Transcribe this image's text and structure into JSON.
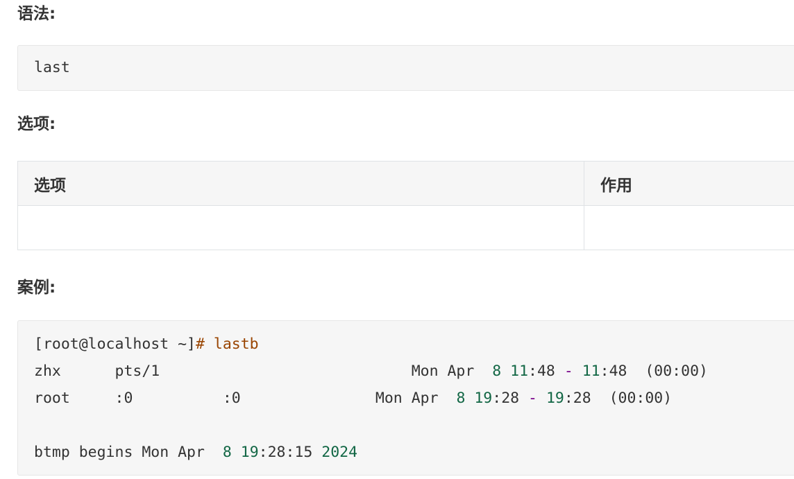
{
  "syntax": {
    "heading": "语法:",
    "code": "last"
  },
  "options": {
    "heading": "选项:",
    "columns": [
      "选项",
      "作用"
    ],
    "rows": [
      [
        "",
        ""
      ]
    ]
  },
  "example": {
    "heading": "案例:",
    "prompt": "[root@localhost ~]",
    "prompt_hash": "#",
    "command": "lastb",
    "lines": [
      {
        "user": "zhx",
        "tty": "pts/1",
        "host": "",
        "dow": "Mon",
        "month": "Apr",
        "day": "8",
        "login_h": "11",
        "login_m": "48",
        "dash": "-",
        "logout_h": "11",
        "logout_m": "48",
        "duration": "(00:00)"
      },
      {
        "user": "root",
        "tty": ":0",
        "host": ":0",
        "dow": "Mon",
        "month": "Apr",
        "day": "8",
        "login_h": "19",
        "login_m": "28",
        "dash": "-",
        "logout_h": "19",
        "logout_m": "28",
        "duration": "(00:00)"
      }
    ],
    "footer": {
      "text": "btmp begins Mon Apr",
      "day": "8",
      "hour": "19",
      "rest": ":28:15",
      "year": "2024"
    }
  },
  "colors": {
    "code_bg": "#f6f6f6",
    "keyword": "#994400",
    "number": "#116644",
    "operator": "#770088",
    "border": "#dfe2e5"
  }
}
